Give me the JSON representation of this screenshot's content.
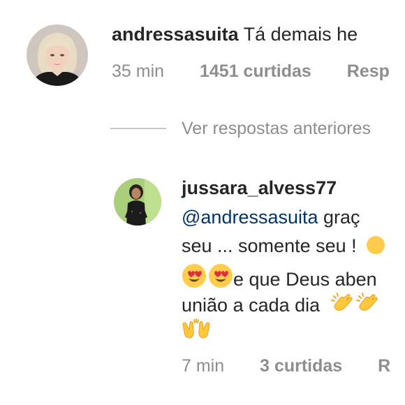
{
  "comment": {
    "username": "andressasuita",
    "text": "Tá demais he",
    "time": "35 min",
    "likes": "1451 curtidas",
    "reply_label": "Resp"
  },
  "view_previous_replies": "Ver respostas anteriores",
  "reply": {
    "username": "jussara_alvess77",
    "mention": "@andressasuita",
    "line1_rest": " graç",
    "line2": "seu ... somente seu !",
    "line3_text": "e que Deus aben",
    "line4": "união a cada dia",
    "time": "7 min",
    "likes": "3 curtidas",
    "reply_label": "R"
  },
  "icons": {
    "heart_eyes": "smiling-face-with-heart-eyes-emoji",
    "clapping": "clapping-hands-emoji",
    "raising_hands": "raising-hands-emoji"
  },
  "colors": {
    "text": "#262626",
    "meta": "#8e8e8e",
    "mention": "#003569",
    "divider": "#c7c7c7"
  }
}
